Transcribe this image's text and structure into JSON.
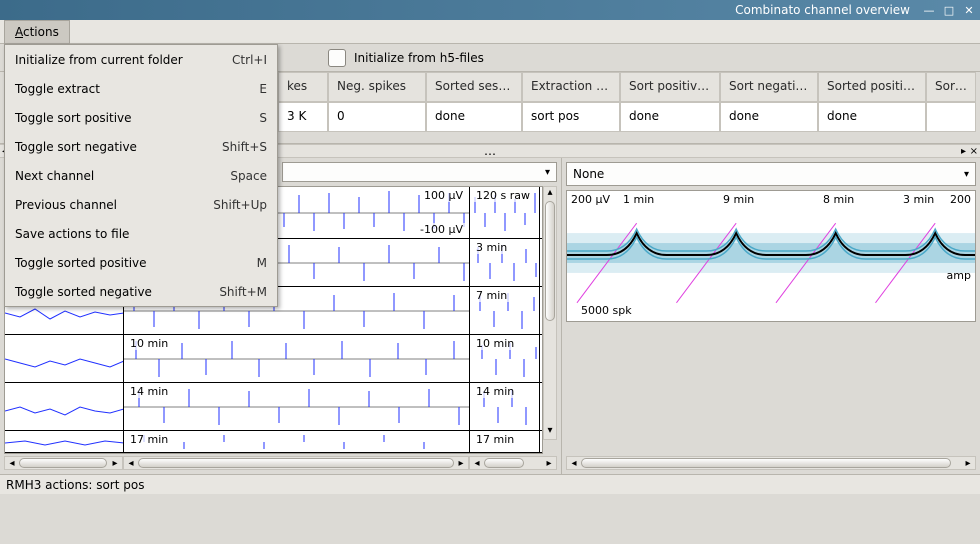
{
  "window": {
    "title": "Combinato channel overview"
  },
  "menubar": {
    "actions_label": "Actions"
  },
  "dropdown_items": [
    {
      "label": "Initialize from current folder",
      "shortcut": "Ctrl+I"
    },
    {
      "label": "Toggle extract",
      "shortcut": "E"
    },
    {
      "label": "Toggle sort positive",
      "shortcut": "S"
    },
    {
      "label": "Toggle sort negative",
      "shortcut": "Shift+S"
    },
    {
      "label": "Next channel",
      "shortcut": "Space"
    },
    {
      "label": "Previous channel",
      "shortcut": "Shift+Up"
    },
    {
      "label": "Save actions to file",
      "shortcut": ""
    },
    {
      "label": "Toggle sorted positive",
      "shortcut": "M"
    },
    {
      "label": "Toggle sorted negative",
      "shortcut": "Shift+M"
    }
  ],
  "toolbar": {
    "checkbox_label": "Initialize from h5-files"
  },
  "table": {
    "headers": {
      "spikes": "kes",
      "neg": "Neg. spikes",
      "sess": "Sorted session",
      "ext": "Extraction act",
      "spos": "Sort positive a",
      "sneg": "Sort negative",
      "sortedpos": "Sorted positive",
      "sortedneg": "Sorted"
    },
    "row": {
      "spikes": "3 K",
      "neg": "0",
      "sess": "done",
      "ext": "sort pos",
      "spos": "done",
      "sneg": "done",
      "sortedpos": "done",
      "sortedneg": ""
    }
  },
  "combos": {
    "left_value": "",
    "right_value": "None"
  },
  "left_plot": {
    "top_right_pos": "100 µV",
    "top_right_neg": "-100 µV",
    "raw_label": "120 s raw",
    "row_labels": [
      "3 min",
      "7 min",
      "10 min",
      "14 min",
      "17 min"
    ],
    "mini_labels": [
      "3 min",
      "7 min",
      "10 min",
      "14 min",
      "17 min"
    ]
  },
  "right_plot": {
    "yaxis_top": "200 µV",
    "yaxis_bot": "200",
    "ticks": [
      "1 min",
      "9 min",
      "8 min",
      "3 min"
    ],
    "spk_count": "5000 spk",
    "amp_label": "amp"
  },
  "status": {
    "text": "RMH3 actions:  sort pos"
  },
  "colors": {
    "accent": "#2030ff",
    "pink": "#e040e0",
    "cyan": "#4aa8c8"
  },
  "ellipsis": "…"
}
